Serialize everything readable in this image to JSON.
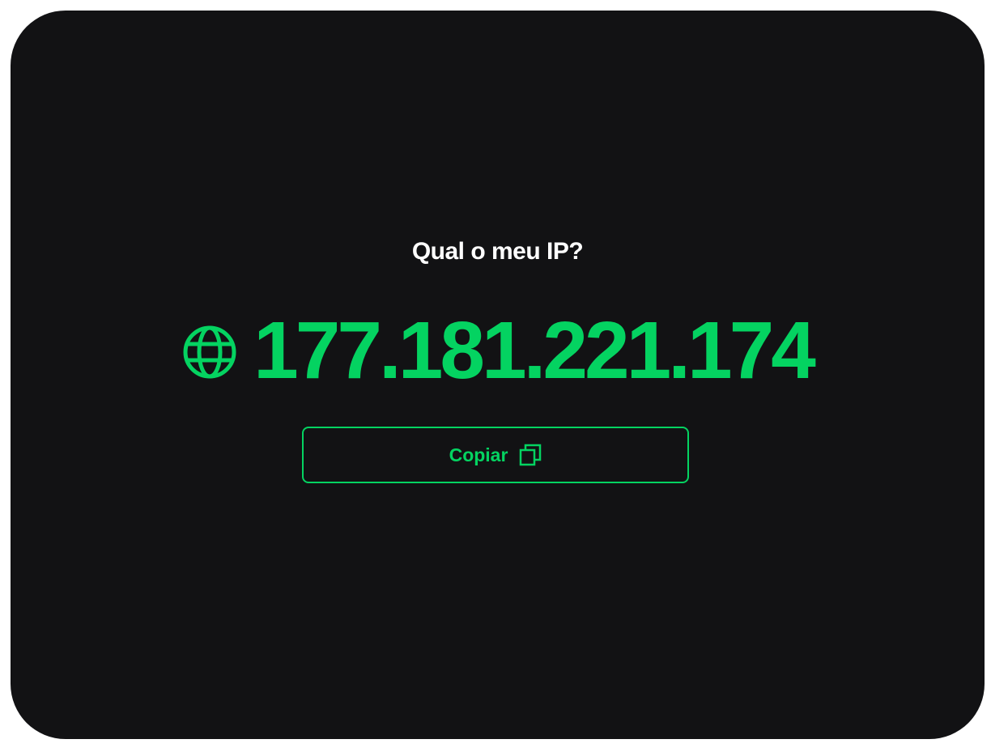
{
  "page": {
    "title": "Qual o meu IP?"
  },
  "ip": {
    "value": "177.181.221.174",
    "icon": "globe-icon"
  },
  "copy_button": {
    "label": "Copiar",
    "icon": "copy-icon"
  },
  "colors": {
    "background": "#121214",
    "accent": "#04d361",
    "text": "#ffffff"
  }
}
